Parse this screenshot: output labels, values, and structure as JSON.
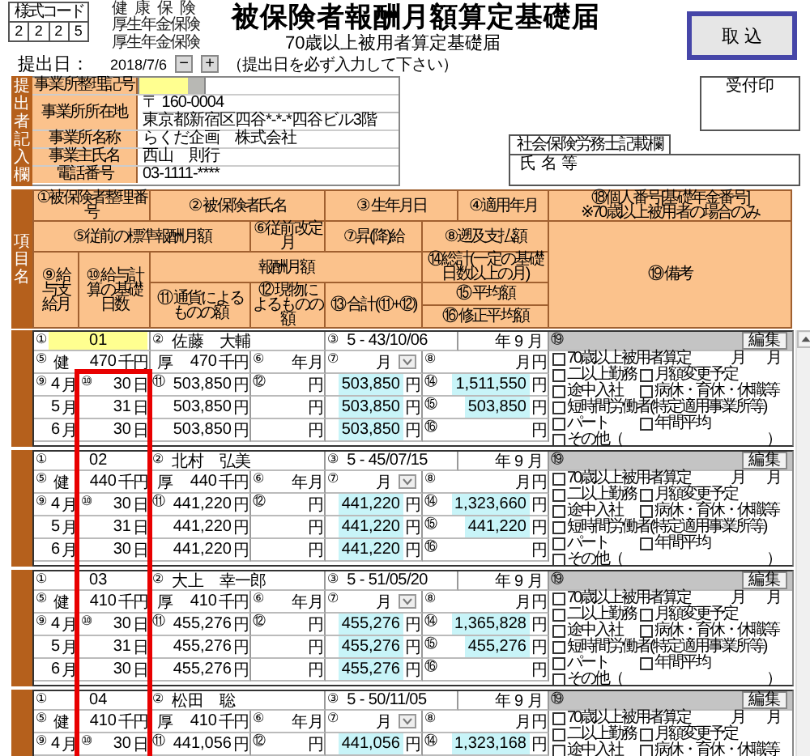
{
  "form_code": {
    "label": "様式コード",
    "digits": [
      "2",
      "2",
      "2",
      "5"
    ]
  },
  "insurance_labels": [
    "健康保険",
    "厚生年金保険",
    "厚生年金保険"
  ],
  "title": "被保険者報酬月額算定基礎届",
  "subtitle": "70歳以上被用者算定基礎届",
  "import_button": "取 込",
  "submission": {
    "label": "提出日：",
    "date": "2018/7/6",
    "decrement": "−",
    "increment": "+",
    "note": "（提出日を必ず入力して下さい）"
  },
  "submitter": {
    "side_label": "提出者記入欄",
    "office_code": {
      "label": "事業所整理記号",
      "highlighted": true
    },
    "fields": [
      {
        "label": "事業所所在地",
        "lines": [
          "〒 160-0004",
          "東京都新宿区四谷*-*-*四谷ビル3階"
        ]
      },
      {
        "label": "事業所名称",
        "lines": [
          "らくだ企画　株式会社"
        ]
      },
      {
        "label": "事業主氏名",
        "lines": [
          "西山　則行"
        ]
      },
      {
        "label": "電話番号",
        "lines": [
          "03-1111-****"
        ]
      }
    ]
  },
  "reception_stamp": "受付印",
  "agent": {
    "label": "社会保険労務士記載欄",
    "name_label": "氏 名 等"
  },
  "item_header": {
    "side_label": "項目名",
    "cells": [
      {
        "text": "①被保険者整理番号"
      },
      {
        "text": "② 被保険者氏名"
      },
      {
        "text": "③ 生年月日"
      },
      {
        "text": "④適用年月"
      },
      {
        "text": "⑱個人番号[基礎年金番号]",
        "note": "※70歳以上被用者の場合のみ"
      },
      {
        "text": "⑤従前の標準報酬月額"
      },
      {
        "text": "⑥従前改定月"
      },
      {
        "text": "⑦昇(降)給"
      },
      {
        "text": "⑧遡及支払額"
      },
      {
        "text": "⑨ 給与支給月"
      },
      {
        "text": "⑩ 給与計算の基礎日数"
      },
      {
        "text": "報酬月額"
      },
      {
        "text": "⑭総計(一定の基礎日数以上の月)"
      },
      {
        "text": "⑪ 通貨によるものの額"
      },
      {
        "text": "⑫ 現物によるものの額"
      },
      {
        "text": "⑬ 合計(⑪+⑫)"
      },
      {
        "text": "⑮ 平均額"
      },
      {
        "text": "⑯ 修正平均額"
      },
      {
        "text": "⑲ 備考"
      }
    ]
  },
  "records": [
    {
      "number_mark": "①",
      "number": "01",
      "number_focused": true,
      "name_mark": "②",
      "name": "佐藤　大輔",
      "birth_mark": "③",
      "birth": "5 - 43/10/06",
      "applied": "年 9 月",
      "remarks_mark": "⑲",
      "edit_button": "編集",
      "row_b": {
        "health_mark": "⑤",
        "health_label": "健",
        "health": "470",
        "health_unit": "千円",
        "pension_label": "厚",
        "pension": "470",
        "pension_unit": "千円",
        "prior_mark": "⑥",
        "prior_year_unit": "年",
        "prior_month_unit": "月",
        "raise_mark": "⑦",
        "raise_month_unit": "月",
        "retro_mark": "⑧",
        "retro_month_unit": "月",
        "retro_unit": "円"
      },
      "months": [
        {
          "month_mark": "⑨",
          "month": "4",
          "month_unit": "月",
          "days_mark": "⑩",
          "days": "30",
          "days_unit": "日",
          "cash_mark": "⑪",
          "cash": "503,850",
          "cash_unit": "円",
          "in_kind_mark": "⑫",
          "in_kind_unit": "円",
          "total": "503,850",
          "total_unit": "円",
          "summary_mark": "⑭",
          "summary": "1,511,550",
          "summary_unit": "円"
        },
        {
          "month": "5",
          "month_unit": "月",
          "days": "31",
          "days_unit": "日",
          "cash": "503,850",
          "cash_unit": "円",
          "in_kind_unit": "円",
          "total": "503,850",
          "total_unit": "円",
          "summary_mark": "⑮",
          "summary": "503,850",
          "summary_unit": "円"
        },
        {
          "month": "6",
          "month_unit": "月",
          "days": "30",
          "days_unit": "日",
          "cash": "503,850",
          "cash_unit": "円",
          "in_kind_unit": "円",
          "total": "503,850",
          "total_unit": "円",
          "summary_mark": "⑯",
          "summary_unit": "円"
        }
      ],
      "remarks": [
        [
          {
            "kind": "checkbox",
            "label": "70歳以上被用者算定",
            "checked": false
          },
          {
            "kind": "text",
            "label": "月"
          },
          {
            "kind": "text",
            "label": "月"
          }
        ],
        [
          {
            "kind": "checkbox",
            "label": "二以上勤務",
            "checked": false
          },
          {
            "kind": "checkbox",
            "label": "月額変更予定",
            "checked": false
          }
        ],
        [
          {
            "kind": "checkbox",
            "label": "途中入社",
            "checked": false
          },
          {
            "kind": "checkbox",
            "label": "病休・育休・休職等",
            "checked": false
          }
        ],
        [
          {
            "kind": "checkbox",
            "label": "短時間労働者(特定適用事業所等)",
            "checked": false
          }
        ],
        [
          {
            "kind": "checkbox",
            "label": "パート",
            "checked": false
          },
          {
            "kind": "checkbox",
            "label": "年間平均",
            "checked": false
          }
        ],
        [
          {
            "kind": "checkbox",
            "label": "その他（",
            "checked": false
          },
          {
            "kind": "text",
            "label": "）"
          }
        ]
      ]
    },
    {
      "number_mark": "①",
      "number": "02",
      "number_focused": false,
      "name_mark": "②",
      "name": "北村　弘美",
      "birth_mark": "③",
      "birth": "5 - 45/07/15",
      "applied": "年 9 月",
      "remarks_mark": "⑲",
      "edit_button": "編集",
      "row_b": {
        "health_mark": "⑤",
        "health_label": "健",
        "health": "440",
        "health_unit": "千円",
        "pension_label": "厚",
        "pension": "440",
        "pension_unit": "千円",
        "prior_mark": "⑥",
        "prior_year_unit": "年",
        "prior_month_unit": "月",
        "raise_mark": "⑦",
        "raise_month_unit": "月",
        "retro_mark": "⑧",
        "retro_month_unit": "月",
        "retro_unit": "円"
      },
      "months": [
        {
          "month_mark": "⑨",
          "month": "4",
          "month_unit": "月",
          "days_mark": "⑩",
          "days": "30",
          "days_unit": "日",
          "cash_mark": "⑪",
          "cash": "441,220",
          "cash_unit": "円",
          "in_kind_mark": "⑫",
          "in_kind_unit": "円",
          "total": "441,220",
          "total_unit": "円",
          "summary_mark": "⑭",
          "summary": "1,323,660",
          "summary_unit": "円"
        },
        {
          "month": "5",
          "month_unit": "月",
          "days": "31",
          "days_unit": "日",
          "cash": "441,220",
          "cash_unit": "円",
          "in_kind_unit": "円",
          "total": "441,220",
          "total_unit": "円",
          "summary_mark": "⑮",
          "summary": "441,220",
          "summary_unit": "円"
        },
        {
          "month": "6",
          "month_unit": "月",
          "days": "30",
          "days_unit": "日",
          "cash": "441,220",
          "cash_unit": "円",
          "in_kind_unit": "円",
          "total": "441,220",
          "total_unit": "円",
          "summary_mark": "⑯",
          "summary_unit": "円"
        }
      ],
      "remarks": [
        [
          {
            "kind": "checkbox",
            "label": "70歳以上被用者算定",
            "checked": false
          },
          {
            "kind": "text",
            "label": "月"
          },
          {
            "kind": "text",
            "label": "月"
          }
        ],
        [
          {
            "kind": "checkbox",
            "label": "二以上勤務",
            "checked": false
          },
          {
            "kind": "checkbox",
            "label": "月額変更予定",
            "checked": false
          }
        ],
        [
          {
            "kind": "checkbox",
            "label": "途中入社",
            "checked": false
          },
          {
            "kind": "checkbox",
            "label": "病休・育休・休職等",
            "checked": false
          }
        ],
        [
          {
            "kind": "checkbox",
            "label": "短時間労働者(特定適用事業所等)",
            "checked": false
          }
        ],
        [
          {
            "kind": "checkbox",
            "label": "パート",
            "checked": false
          },
          {
            "kind": "checkbox",
            "label": "年間平均",
            "checked": false
          }
        ],
        [
          {
            "kind": "checkbox",
            "label": "その他（",
            "checked": false
          },
          {
            "kind": "text",
            "label": "）"
          }
        ]
      ]
    },
    {
      "number_mark": "①",
      "number": "03",
      "number_focused": false,
      "name_mark": "②",
      "name": "大上　幸一郎",
      "birth_mark": "③",
      "birth": "5 - 51/05/20",
      "applied": "年 9 月",
      "remarks_mark": "⑲",
      "edit_button": "編集",
      "row_b": {
        "health_mark": "⑤",
        "health_label": "健",
        "health": "410",
        "health_unit": "千円",
        "pension_label": "厚",
        "pension": "410",
        "pension_unit": "千円",
        "prior_mark": "⑥",
        "prior_year_unit": "年",
        "prior_month_unit": "月",
        "raise_mark": "⑦",
        "raise_month_unit": "月",
        "retro_mark": "⑧",
        "retro_month_unit": "月",
        "retro_unit": "円"
      },
      "months": [
        {
          "month_mark": "⑨",
          "month": "4",
          "month_unit": "月",
          "days_mark": "⑩",
          "days": "30",
          "days_unit": "日",
          "cash_mark": "⑪",
          "cash": "455,276",
          "cash_unit": "円",
          "in_kind_mark": "⑫",
          "in_kind_unit": "円",
          "total": "455,276",
          "total_unit": "円",
          "summary_mark": "⑭",
          "summary": "1,365,828",
          "summary_unit": "円"
        },
        {
          "month": "5",
          "month_unit": "月",
          "days": "31",
          "days_unit": "日",
          "cash": "455,276",
          "cash_unit": "円",
          "in_kind_unit": "円",
          "total": "455,276",
          "total_unit": "円",
          "summary_mark": "⑮",
          "summary": "455,276",
          "summary_unit": "円"
        },
        {
          "month": "6",
          "month_unit": "月",
          "days": "30",
          "days_unit": "日",
          "cash": "455,276",
          "cash_unit": "円",
          "in_kind_unit": "円",
          "total": "455,276",
          "total_unit": "円",
          "summary_mark": "⑯",
          "summary_unit": "円"
        }
      ],
      "remarks": [
        [
          {
            "kind": "checkbox",
            "label": "70歳以上被用者算定",
            "checked": false
          },
          {
            "kind": "text",
            "label": "月"
          },
          {
            "kind": "text",
            "label": "月"
          }
        ],
        [
          {
            "kind": "checkbox",
            "label": "二以上勤務",
            "checked": false
          },
          {
            "kind": "checkbox",
            "label": "月額変更予定",
            "checked": false
          }
        ],
        [
          {
            "kind": "checkbox",
            "label": "途中入社",
            "checked": false
          },
          {
            "kind": "checkbox",
            "label": "病休・育休・休職等",
            "checked": false
          }
        ],
        [
          {
            "kind": "checkbox",
            "label": "短時間労働者(特定適用事業所等)",
            "checked": false
          }
        ],
        [
          {
            "kind": "checkbox",
            "label": "パート",
            "checked": false
          },
          {
            "kind": "checkbox",
            "label": "年間平均",
            "checked": false
          }
        ],
        [
          {
            "kind": "checkbox",
            "label": "その他（",
            "checked": false
          },
          {
            "kind": "text",
            "label": "）"
          }
        ]
      ]
    },
    {
      "number_mark": "①",
      "number": "04",
      "number_focused": false,
      "name_mark": "②",
      "name": "松田　聡",
      "birth_mark": "③",
      "birth": "5 - 50/11/05",
      "applied": "年 9 月",
      "remarks_mark": "⑲",
      "edit_button": "編集",
      "row_b": {
        "health_mark": "⑤",
        "health_label": "健",
        "health": "410",
        "health_unit": "千円",
        "pension_label": "厚",
        "pension": "410",
        "pension_unit": "千円",
        "prior_mark": "⑥",
        "prior_year_unit": "年",
        "prior_month_unit": "月",
        "raise_mark": "⑦",
        "raise_month_unit": "月",
        "retro_mark": "⑧",
        "retro_month_unit": "月",
        "retro_unit": "円"
      },
      "months": [
        {
          "month_mark": "⑨",
          "month": "4",
          "month_unit": "月",
          "days_mark": "⑩",
          "days": "30",
          "days_unit": "日",
          "cash_mark": "⑪",
          "cash": "441,056",
          "cash_unit": "円",
          "in_kind_mark": "⑫",
          "in_kind_unit": "円",
          "total": "441,056",
          "total_unit": "円",
          "summary_mark": "⑭",
          "summary": "1,323,168",
          "summary_unit": "円"
        }
      ],
      "remarks": [
        [
          {
            "kind": "checkbox",
            "label": "70歳以上被用者算定",
            "checked": false
          },
          {
            "kind": "text",
            "label": "月"
          },
          {
            "kind": "text",
            "label": "月"
          }
        ],
        [
          {
            "kind": "checkbox",
            "label": "二以上勤務",
            "checked": false
          },
          {
            "kind": "checkbox",
            "label": "月額変更予定",
            "checked": false
          }
        ],
        [
          {
            "kind": "checkbox",
            "label": "途中入社",
            "checked": false
          },
          {
            "kind": "checkbox",
            "label": "病休・育休・休職等",
            "checked": false
          }
        ]
      ]
    }
  ]
}
